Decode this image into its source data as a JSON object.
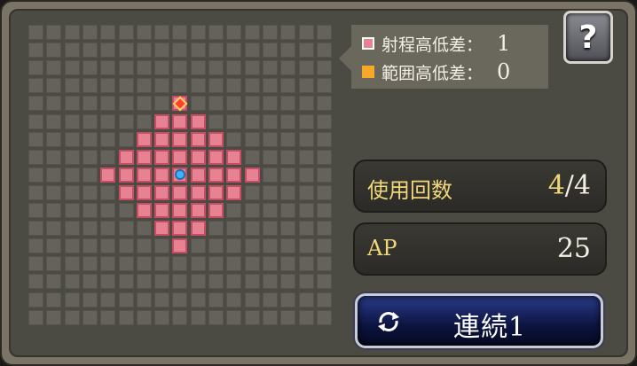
{
  "legend": {
    "range_height": {
      "label": "射程高低差：",
      "value": "1",
      "color": "#e78293"
    },
    "area_height": {
      "label": "範囲高低差：",
      "value": "0",
      "color": "#f7a827"
    }
  },
  "help": {
    "glyph": "?"
  },
  "uses": {
    "label": "使用回数",
    "current": "4",
    "sep_max": "/4"
  },
  "ap": {
    "label": "AP",
    "value": "25"
  },
  "chain_button": {
    "label": "連続1",
    "icon": "cycle-arrows-icon"
  },
  "grid_info": {
    "columns": 17,
    "rows": 17,
    "range_radius": 4
  },
  "colors": {
    "range_fill": "#e78293",
    "area_marker": "#f7a827",
    "caster": "#3fb4ff",
    "target": "#ff4030"
  }
}
